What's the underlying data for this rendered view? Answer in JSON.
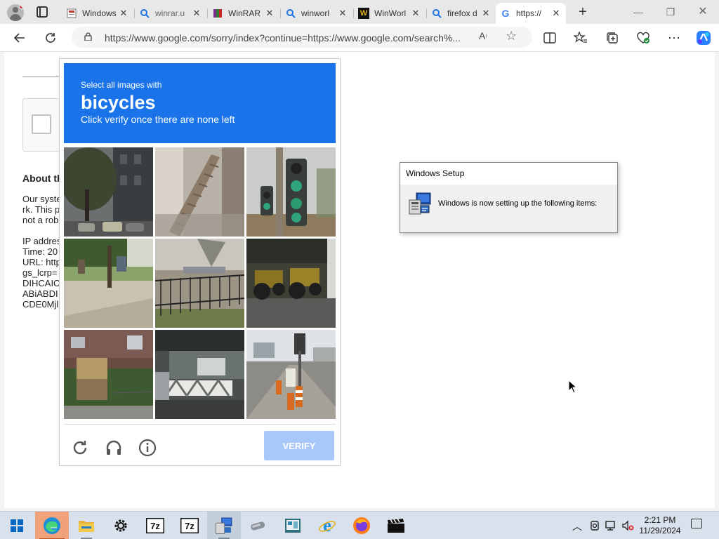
{
  "browser": {
    "tabs": [
      {
        "label": "Windows",
        "icon": "page-icon"
      },
      {
        "label": "winrar.u",
        "icon": "search-icon"
      },
      {
        "label": "WinRAR",
        "icon": "winrar-icon"
      },
      {
        "label": "winworl",
        "icon": "search-icon"
      },
      {
        "label": "WinWorl",
        "icon": "winworld-icon"
      },
      {
        "label": "firefox d",
        "icon": "search-icon"
      },
      {
        "label": "https://",
        "icon": "google-icon"
      }
    ],
    "new_tab": "+",
    "url": "https://www.google.com/sorry/index?continue=https://www.google.com/search%..."
  },
  "sorry_page": {
    "heading": "About th",
    "lines": [
      "Our syste",
      "rk. This p",
      "not a rob",
      "",
      "IP addres",
      "Time: 20",
      "URL: http",
      "gs_lcrp=",
      "DIHCAIC",
      "ABiABDI",
      "CDE0Mjl"
    ]
  },
  "recaptcha": {
    "prompt_small": "Select all images with",
    "target": "bicycles",
    "instruction": "Click verify once there are none left",
    "verify_label": "VERIFY",
    "header_color": "#1a73e8",
    "verify_color": "#a8c7fa"
  },
  "setup_dialog": {
    "title": "Windows Setup",
    "message": "Windows is now setting up the following items:"
  },
  "taskbar": {
    "apps": [
      "start-icon",
      "edge-icon",
      "file-explorer-icon",
      "settings-icon",
      "7zip-icon",
      "7zip-icon",
      "setup-icon",
      "usb-drive-icon",
      "control-panel-icon",
      "internet-explorer-icon",
      "firefox-icon",
      "clapper-icon"
    ],
    "time": "2:21 PM",
    "date": "11/29/2024"
  }
}
